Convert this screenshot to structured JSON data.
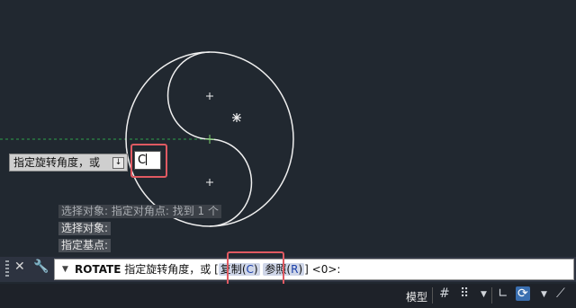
{
  "colors": {
    "background": "#212830",
    "geometry": "#ffffff",
    "dashed_line": "#2ea04a",
    "highlight": "#e05a62"
  },
  "tooltip": {
    "prompt": "指定旋转角度，或",
    "icon": "down-arrow-icon"
  },
  "input": {
    "value": "C"
  },
  "history": {
    "line1": "选择对象: 指定对角点: 找到 1 个",
    "line2": "选择对象:",
    "line3": "指定基点:"
  },
  "command": {
    "name": "ROTATE",
    "prompt": "指定旋转角度，或",
    "bracket_open": "[",
    "option1_label": "复制",
    "option1_key": "C",
    "option2_label": "参照",
    "option2_key": "R",
    "bracket_close": "]",
    "default": "<0>:"
  },
  "status": {
    "model_tab": "模型"
  }
}
